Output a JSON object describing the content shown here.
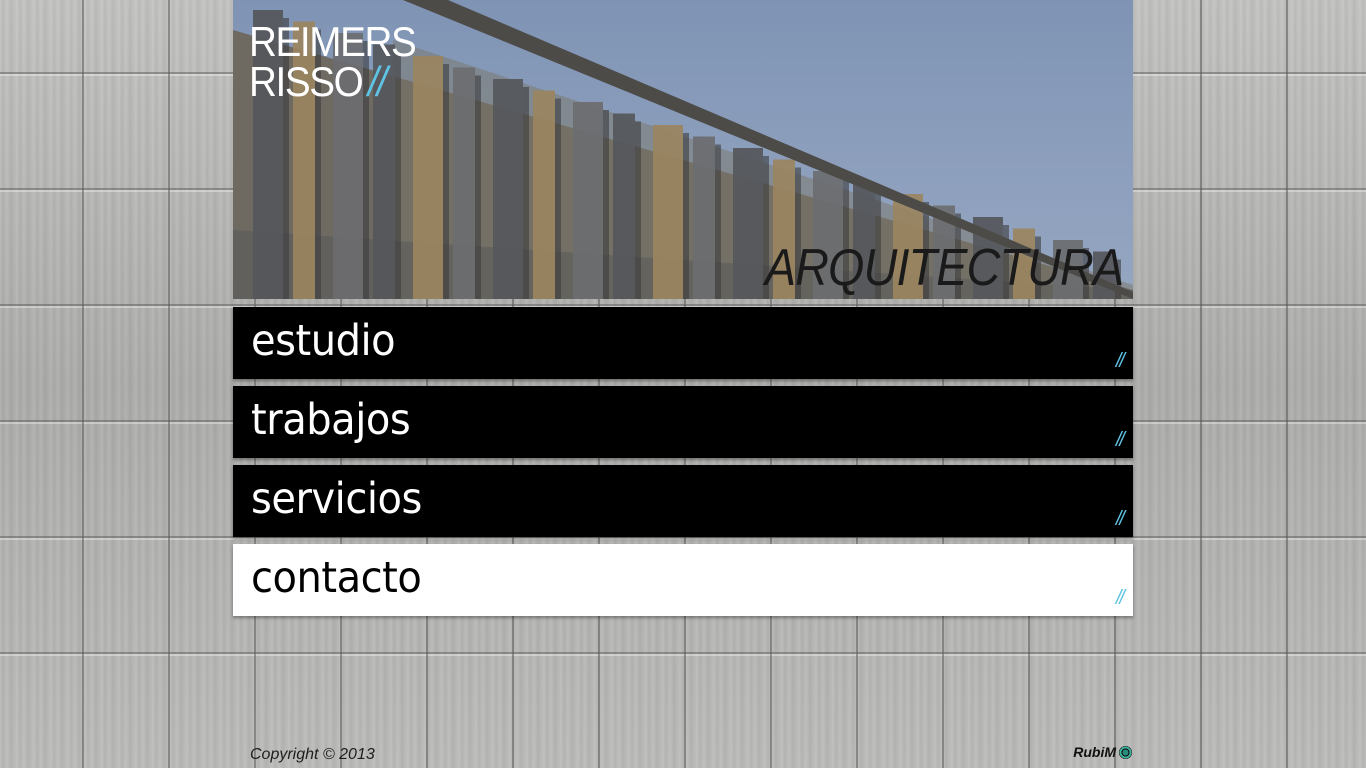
{
  "brand": {
    "line1": "REIMERS",
    "line2": "RISSO",
    "accent": "//",
    "accent_color": "#5fc3e4"
  },
  "hero": {
    "caption": "ARQUITECTURA"
  },
  "menu": {
    "items": [
      {
        "label": "estudio",
        "slash": "//"
      },
      {
        "label": "trabajos",
        "slash": "//"
      },
      {
        "label": "servicios",
        "slash": "//"
      },
      {
        "label": "contacto",
        "slash": "//"
      }
    ],
    "active_index": 3
  },
  "footer": {
    "copyright": "Copyright © 2013",
    "credit": "RubiM",
    "credit_icon": "rubim-logo-icon"
  }
}
